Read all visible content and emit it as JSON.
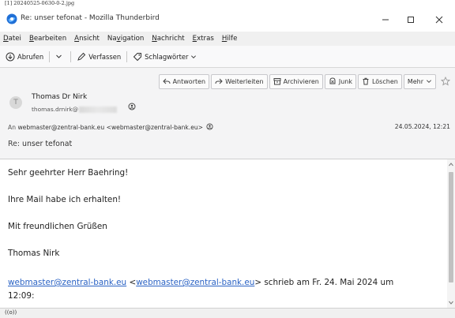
{
  "caption": "[1] 20240525-0630-0-2.jpg",
  "window": {
    "title": "Re: unser tefonat - Mozilla Thunderbird"
  },
  "menubar": {
    "items": [
      {
        "underline": "D",
        "rest": "atei"
      },
      {
        "underline": "B",
        "rest": "earbeiten"
      },
      {
        "underline": "A",
        "rest": "nsicht"
      },
      {
        "underline": "Nav",
        "rest": "igation",
        "mnemonic_index": 2
      },
      {
        "underline": "N",
        "rest": "achricht"
      },
      {
        "underline": "E",
        "rest": "xtras"
      },
      {
        "underline": "H",
        "rest": "ilfe"
      }
    ]
  },
  "toolbar": {
    "get_messages": "Abrufen",
    "write": "Verfassen",
    "tags": "Schlagwörter"
  },
  "header": {
    "actions": [
      "Antworten",
      "Weiterleiten",
      "Archivieren",
      "Junk",
      "Löschen",
      "Mehr"
    ],
    "sender_name": "Thomas Dr Nirk",
    "sender_email": "thomas.drnirk@",
    "to_label": "An",
    "to_value": "webmaster@zentral-bank.eu <webmaster@zentral-bank.eu>",
    "date": "24.05.2024, 12:21",
    "subject_label": "Re:",
    "subject": "unser tefonat"
  },
  "body": {
    "greeting": "Sehr geehrter Herr Baehring!",
    "line1": "Ihre Mail habe ich erhalten!",
    "closing": "Mit freundlichen Grüßen",
    "signature": "Thomas Nirk",
    "quote_link1": "webmaster@zentral-bank.eu",
    "quote_lt": "<",
    "quote_link2": "webmaster@zentral-bank.eu",
    "quote_text": "> schrieb am Fr. 24. Mai 2024 um",
    "quote_time": "12:09:"
  },
  "statusbar": {
    "indicator": "((o))"
  },
  "colors": {
    "link": "#2a62c4",
    "header_bg": "#f4f4f5",
    "menubar_bg": "#f0f0f0"
  }
}
